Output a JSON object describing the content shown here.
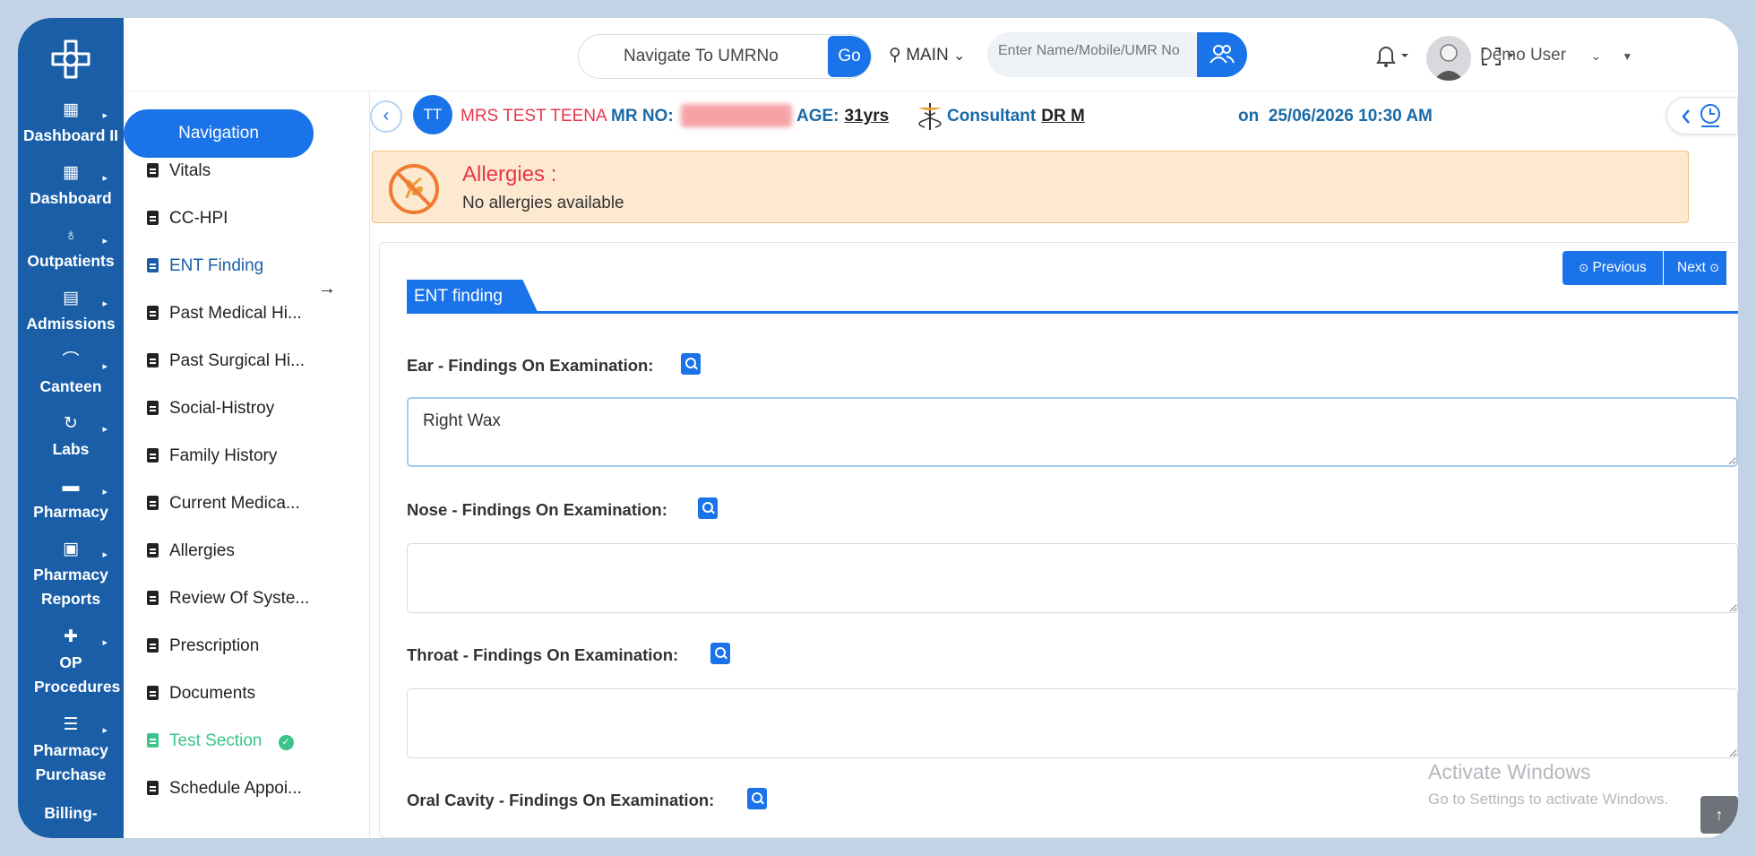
{
  "topbar": {
    "umr_placeholder": "Navigate To UMRNo",
    "go_label": "Go",
    "location": "MAIN",
    "search_placeholder": "Enter Name/Mobile/UMR No",
    "user_name": "Demo User"
  },
  "rail": {
    "items": [
      {
        "label": "Dashboard II",
        "icon": "grid-icon"
      },
      {
        "label": "Dashboard",
        "icon": "grid-icon"
      },
      {
        "label": "Outpatients",
        "icon": "stethoscope-icon"
      },
      {
        "label": "Admissions",
        "icon": "clipboard-icon"
      },
      {
        "label": "Canteen",
        "icon": "food-icon"
      },
      {
        "label": "Labs",
        "icon": "lab-icon"
      },
      {
        "label": "Pharmacy",
        "icon": "store-icon"
      },
      {
        "label": "Pharmacy Reports",
        "icon": "save-icon"
      },
      {
        "label": "OP Procedures",
        "icon": "medical-kit-icon"
      },
      {
        "label": "Pharmacy Purchase",
        "icon": "checklist-icon"
      },
      {
        "label": "Billing-",
        "icon": "bill-icon"
      }
    ]
  },
  "nav": {
    "title": "Navigation",
    "items": [
      {
        "label": "Vitals",
        "state": "normal"
      },
      {
        "label": "CC-HPI",
        "state": "normal"
      },
      {
        "label": "ENT Finding",
        "state": "active"
      },
      {
        "label": "Past Medical Hi...",
        "state": "normal"
      },
      {
        "label": "Past Surgical Hi...",
        "state": "normal"
      },
      {
        "label": "Social-Histroy",
        "state": "normal"
      },
      {
        "label": "Family History",
        "state": "normal"
      },
      {
        "label": "Current Medica...",
        "state": "normal"
      },
      {
        "label": "Allergies",
        "state": "normal"
      },
      {
        "label": "Review Of Syste...",
        "state": "normal"
      },
      {
        "label": "Prescription",
        "state": "normal"
      },
      {
        "label": "Documents",
        "state": "normal"
      },
      {
        "label": "Test Section",
        "state": "done"
      },
      {
        "label": "Schedule Appoi...",
        "state": "normal"
      }
    ]
  },
  "patient": {
    "initials": "TT",
    "name": "MRS TEST TEENA",
    "mr_label": "MR NO:",
    "age_label": "AGE:",
    "age": "31yrs",
    "consultant_label": "Consultant",
    "consultant": "DR M",
    "on_label": "on",
    "datetime": "25/06/2026 10:30 AM"
  },
  "allergy": {
    "title": "Allergies :",
    "value": "No allergies available"
  },
  "form": {
    "previous_label": "Previous",
    "next_label": "Next",
    "section_title": "ENT finding",
    "fields": [
      {
        "label": "Ear - Findings On Examination:",
        "value": "Right Wax"
      },
      {
        "label": "Nose - Findings On Examination:",
        "value": ""
      },
      {
        "label": "Throat - Findings On Examination:",
        "value": ""
      },
      {
        "label": "Oral Cavity - Findings On Examination:",
        "value": ""
      }
    ]
  },
  "watermark": {
    "line1": "Activate Windows",
    "line2": "Go to Settings to activate Windows."
  },
  "colors": {
    "primary": "#1a73e8",
    "rail": "#1a5ea8",
    "danger": "#e8364a",
    "success": "#3ac48c"
  }
}
